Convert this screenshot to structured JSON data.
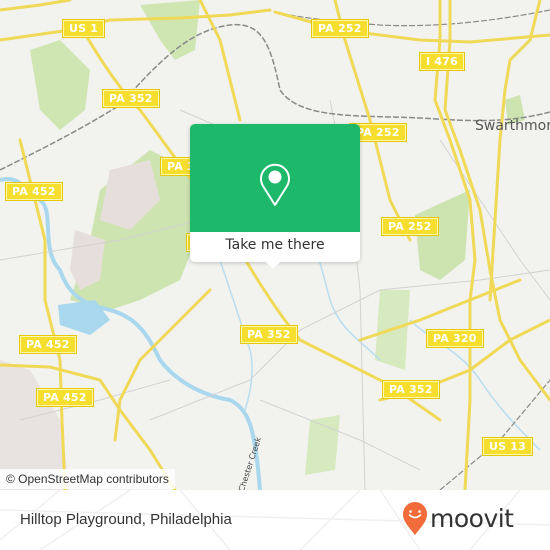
{
  "map": {
    "route_shields": [
      {
        "id": "us1",
        "label": "US 1"
      },
      {
        "id": "pa252-top",
        "label": "PA 252"
      },
      {
        "id": "i476",
        "label": "I 476"
      },
      {
        "id": "pa352-nw",
        "label": "PA 352"
      },
      {
        "id": "pa252-mid",
        "label": "PA 252"
      },
      {
        "id": "pa3-hidden",
        "label": "PA 3"
      },
      {
        "id": "pa452-w",
        "label": "PA 452"
      },
      {
        "id": "pa252-east",
        "label": "PA 252"
      },
      {
        "id": "pa352-center",
        "label": "PA 352"
      },
      {
        "id": "pa320",
        "label": "PA 320"
      },
      {
        "id": "pa452-sw",
        "label": "PA 452"
      },
      {
        "id": "pa452-s",
        "label": "PA 452"
      },
      {
        "id": "pa352-se",
        "label": "PA 352"
      },
      {
        "id": "us13",
        "label": "US 13"
      },
      {
        "id": "pa-left-edge",
        "label": "PA 3"
      }
    ],
    "places": [
      {
        "id": "swarthmore",
        "label": "Swarthmore"
      }
    ],
    "waterways": [
      {
        "id": "chester-creek",
        "label": "Chester Creek"
      }
    ],
    "attribution": "© OpenStreetMap contributors",
    "colors": {
      "background": "#f2f2ef",
      "park": "#c8e2a8",
      "water": "#a9d8ee",
      "road_major": "#f5de5c",
      "road_minor": "#cfcfcf",
      "rail": "#808080",
      "shield": "#f5de2e"
    }
  },
  "popup": {
    "icon": "location-pin-icon",
    "button_label": "Take me there",
    "color": "#1db86a"
  },
  "footer": {
    "title": "Hilltop Playground, Philadelphia",
    "brand": "moovit",
    "brand_color": "#f26b3a"
  }
}
